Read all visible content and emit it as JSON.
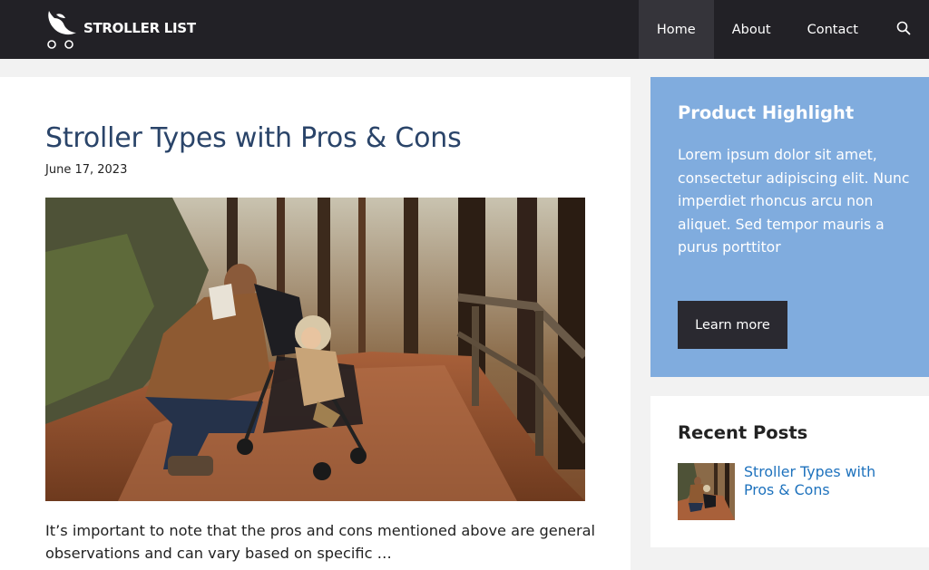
{
  "header": {
    "logo_text": "STROLLER LIST",
    "nav": [
      {
        "label": "Home",
        "active": true
      },
      {
        "label": "About",
        "active": false
      },
      {
        "label": "Contact",
        "active": false
      }
    ],
    "search_icon": "search-icon",
    "colors": {
      "background": "#222126",
      "active_item": "#35343a"
    }
  },
  "post": {
    "title": "Stroller Types with Pros & Cons",
    "date": "June 17, 2023",
    "excerpt": "It’s important to note that the pros and cons mentioned above are general observations and can vary based on specific …",
    "title_color": "#2a4469"
  },
  "sidebar": {
    "highlight": {
      "title": "Product Highlight",
      "text": "Lorem ipsum dolor sit amet, consectetur adipiscing elit. Nunc imperdiet rhoncus arcu non aliquet. Sed tempor mauris a purus porttitor",
      "button": "Learn more",
      "background": "#80acde"
    },
    "recent_posts": {
      "title": "Recent Posts",
      "items": [
        {
          "label": "Stroller Types with Pros & Cons"
        }
      ],
      "link_color": "#1e72bd"
    }
  }
}
